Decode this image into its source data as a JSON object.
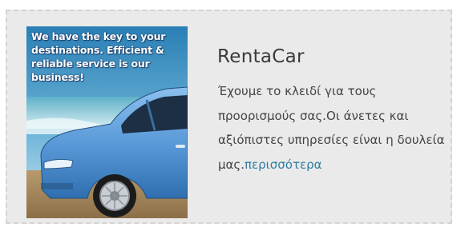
{
  "card": {
    "title": "RentaCar",
    "description": "Έχουμε το κλειδί για τους προορισμούς σας.Οι άνετες και αξιόπιστες υπηρεσίες είναι η δουλεία μας.",
    "more_link": "περισσότερα",
    "image": {
      "overlay_text": "We have the key to your destinations. Efficient & reliable service is our business!"
    }
  },
  "colors": {
    "card_background": "#eaeaea",
    "card_border": "#d3d3d3",
    "title": "#3a3a3a",
    "text": "#444444",
    "link": "#2f7fa3",
    "car_body": "#5a9ad8"
  }
}
